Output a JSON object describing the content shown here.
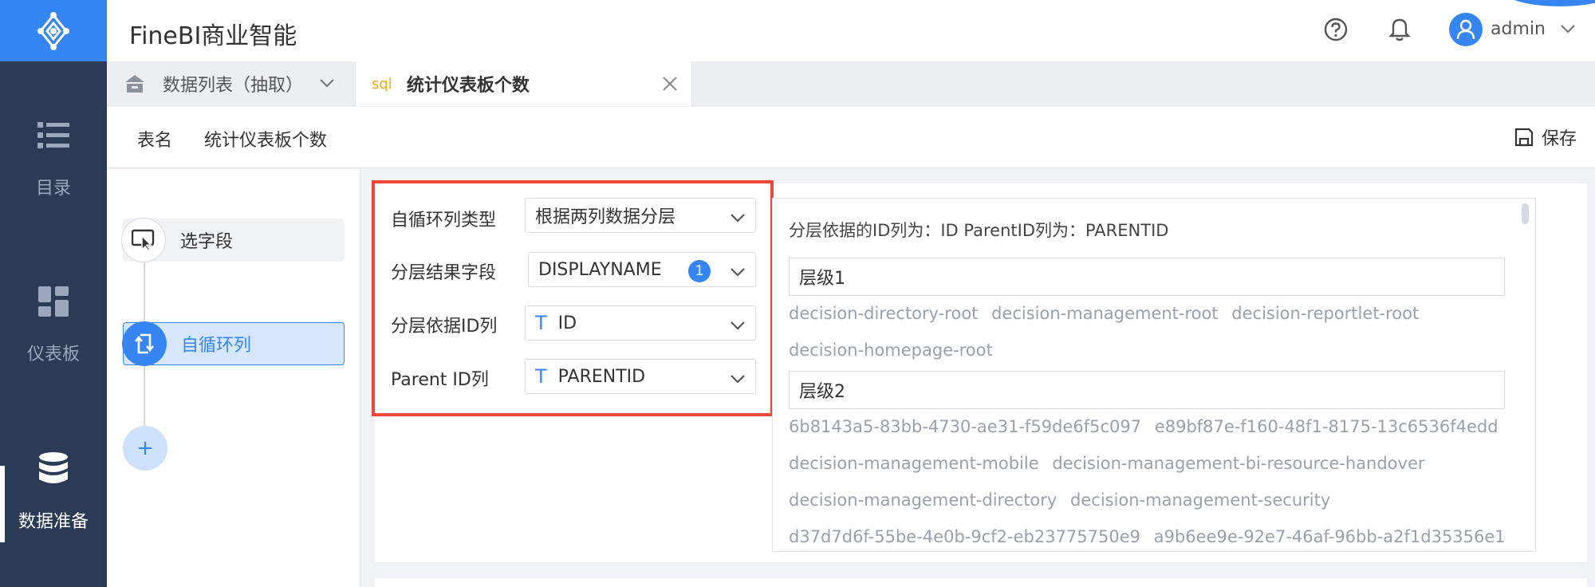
{
  "header": {
    "title": "FineBI商业智能",
    "username": "admin"
  },
  "nav": {
    "items": [
      {
        "label": "目录",
        "icon": "list-icon"
      },
      {
        "label": "仪表板",
        "icon": "dashboard-icon"
      },
      {
        "label": "数据准备",
        "icon": "database-icon",
        "active": true
      }
    ]
  },
  "tabs": {
    "list_label": "数据列表（抽取）",
    "active_badge": "sql",
    "active_label": "统计仪表板个数"
  },
  "subbar": {
    "table_name_label": "表名",
    "table_name_value": "统计仪表板个数",
    "save_label": "保存"
  },
  "flow": {
    "step1_label": "选字段",
    "step2_label": "自循环列",
    "add_label": "+"
  },
  "form": {
    "type_label": "自循环列类型",
    "type_value": "根据两列数据分层",
    "result_label": "分层结果字段",
    "result_value": "DISPLAYNAME",
    "result_count": "1",
    "id_label": "分层依据ID列",
    "id_type_glyph": "T",
    "id_value": "ID",
    "parent_label": "Parent ID列",
    "parent_type_glyph": "T",
    "parent_value": "PARENTID"
  },
  "preview": {
    "heading": "分层依据的ID列为：ID  ParentID列为：PARENTID",
    "level1_label": "层级1",
    "level1_values": [
      [
        "decision-directory-root",
        "decision-management-root",
        "decision-reportlet-root"
      ],
      [
        "decision-homepage-root"
      ]
    ],
    "level2_label": "层级2",
    "level2_values": [
      [
        "6b8143a5-83bb-4730-ae31-f59de6f5c097",
        "e89bf87e-f160-48f1-8175-13c6536f4edd"
      ],
      [
        "decision-management-mobile",
        "decision-management-bi-resource-handover"
      ],
      [
        "decision-management-directory",
        "decision-management-security"
      ],
      [
        "d37d7d6f-55be-4e0b-9cf2-eb23775750e9",
        "a9b6ee9e-92e7-46af-96bb-a2f1d35356e1"
      ]
    ]
  },
  "colors": {
    "primary": "#3685f2",
    "nav_bg": "#2b3a55",
    "highlight_border": "#f0473b",
    "sql_badge": "#f5a623"
  }
}
